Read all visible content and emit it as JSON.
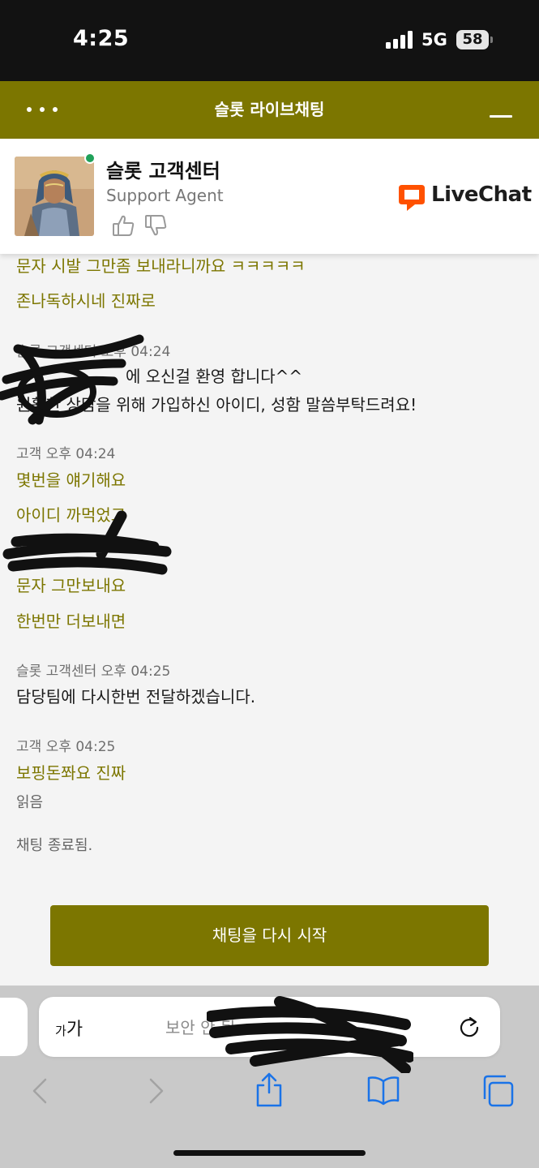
{
  "status_bar": {
    "time": "4:25",
    "network": "5G",
    "battery": "58"
  },
  "header": {
    "title": "슬롯 라이브채팅"
  },
  "agent": {
    "name": "슬롯 고객센터",
    "role": "Support Agent",
    "status_color": "#20a15a",
    "brand": "LiveChat",
    "brand_color": "#ff5100"
  },
  "messages": {
    "m1": "문자 시발 그만좀 보내라니까요 ㅋㅋㅋㅋㅋ",
    "m2": "존나독하시네 진짜로",
    "meta1": "슬롯 고객센터 오후 04:24",
    "a1_line1": "에 오신걸 환영 합니다^^",
    "a1_line2": "원활한 상담을 위해 가입하신 아이디, 성함 말씀부탁드려요!",
    "meta2": "고객 오후 04:24",
    "m3": "몇번을 얘기해요",
    "m4": "아이디 까먹었고",
    "m5": "문자 그만보내요",
    "m6": "한번만 더보내면",
    "meta3": "슬롯 고객센터 오후 04:25",
    "a2": "담당팀에 다시한번 전달하겠습니다.",
    "meta4": "고객 오후 04:25",
    "m7": "보핑돈쫘요 진짜",
    "read": "읽음",
    "ended": "채팅 종료됨."
  },
  "restart_button": "채팅을 다시 시작",
  "browser": {
    "aa_small": "가",
    "aa_large": "가",
    "url_prefix": "보안 안 됨"
  },
  "colors": {
    "accent": "#7c7600",
    "customer_text": "#7c7600",
    "ios_blue": "#1a73e8"
  }
}
